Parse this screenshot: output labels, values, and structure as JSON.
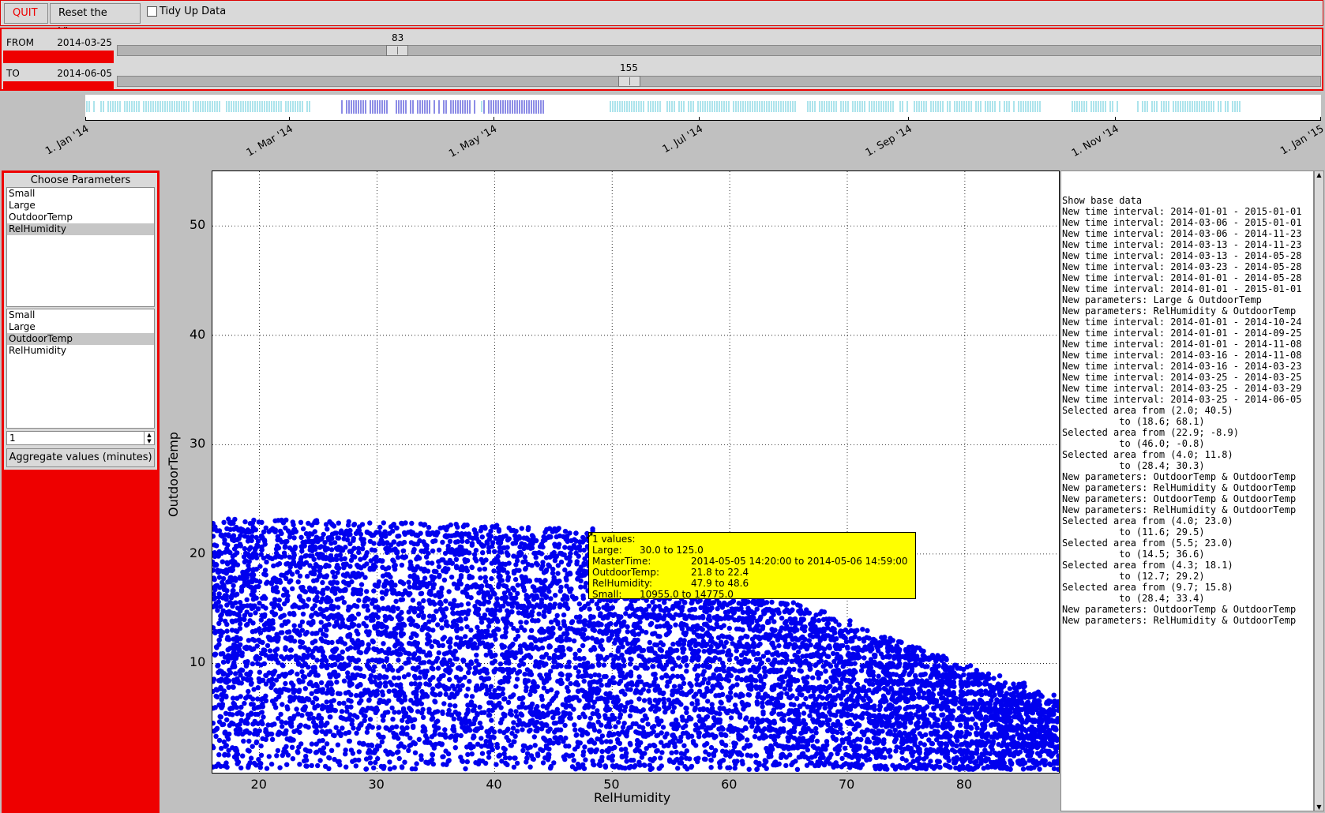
{
  "toolbar": {
    "quit_label": "QUIT",
    "reset_label": "Reset the View",
    "tidy_label": "Tidy Up Data"
  },
  "range": {
    "from_label": "FROM",
    "from_date": "2014-03-25",
    "from_value": "83",
    "to_label": "TO",
    "to_date": "2014-06-05",
    "to_value": "155"
  },
  "timeline": {
    "ticks": [
      "1. Jan '14",
      "1. Mar '14",
      "1. May '14",
      "1. Jul '14",
      "1. Sep '14",
      "1. Nov '14",
      "1. Jan '15"
    ]
  },
  "params": {
    "title": "Choose Parameters",
    "list1": [
      "Small",
      "Large",
      "OutdoorTemp",
      "RelHumidity"
    ],
    "list1_selected": "RelHumidity",
    "list2": [
      "Small",
      "Large",
      "OutdoorTemp",
      "RelHumidity"
    ],
    "list2_selected": "OutdoorTemp",
    "spin_value": "1",
    "aggregate_label": "Aggregate values (minutes)"
  },
  "plot": {
    "xlabel": "RelHumidity",
    "ylabel": "OutdoorTemp",
    "x_ticks": [
      "20",
      "30",
      "40",
      "50",
      "60",
      "70",
      "80"
    ],
    "y_ticks": [
      "10",
      "20",
      "30",
      "40",
      "50"
    ],
    "xlim": [
      16,
      88
    ],
    "ylim": [
      0,
      55
    ],
    "point_color": "#0000ee",
    "grid": true
  },
  "tooltip": {
    "header": "1 values:",
    "rows": [
      {
        "k": "Large:",
        "v": "30.0 to 125.0"
      },
      {
        "k": "MasterTime:",
        "v": "2014-05-05 14:20:00 to 2014-05-06 14:59:00"
      },
      {
        "k": "OutdoorTemp:",
        "v": "21.8 to 22.4"
      },
      {
        "k": "RelHumidity:",
        "v": "47.9 to 48.6"
      },
      {
        "k": "Small:",
        "v": "10955.0 to 14775.0"
      }
    ]
  },
  "log": {
    "lines": [
      "Show base data",
      "New time interval: 2014-01-01 - 2015-01-01",
      "New time interval: 2014-03-06 - 2015-01-01",
      "New time interval: 2014-03-06 - 2014-11-23",
      "New time interval: 2014-03-13 - 2014-11-23",
      "New time interval: 2014-03-13 - 2014-05-28",
      "New time interval: 2014-03-23 - 2014-05-28",
      "New time interval: 2014-01-01 - 2014-05-28",
      "New time interval: 2014-01-01 - 2015-01-01",
      "New parameters: Large & OutdoorTemp",
      "New parameters: RelHumidity & OutdoorTemp",
      "New time interval: 2014-01-01 - 2014-10-24",
      "New time interval: 2014-01-01 - 2014-09-25",
      "New time interval: 2014-01-01 - 2014-11-08",
      "New time interval: 2014-03-16 - 2014-11-08",
      "New time interval: 2014-03-16 - 2014-03-23",
      "New time interval: 2014-03-25 - 2014-03-25",
      "New time interval: 2014-03-25 - 2014-03-29",
      "New time interval: 2014-03-25 - 2014-06-05",
      "Selected area from (2.0; 40.5)",
      "          to (18.6; 68.1)",
      "Selected area from (22.9; -8.9)",
      "          to (46.0; -0.8)",
      "Selected area from (4.0; 11.8)",
      "          to (28.4; 30.3)",
      "New parameters: OutdoorTemp & OutdoorTemp",
      "New parameters: RelHumidity & OutdoorTemp",
      "New parameters: OutdoorTemp & OutdoorTemp",
      "New parameters: RelHumidity & OutdoorTemp",
      "Selected area from (4.0; 23.0)",
      "          to (11.6; 29.5)",
      "Selected area from (5.5; 23.0)",
      "          to (14.5; 36.6)",
      "Selected area from (4.3; 18.1)",
      "          to (12.7; 29.2)",
      "Selected area from (9.7; 15.8)",
      "          to (28.4; 33.4)",
      "New parameters: OutdoorTemp & OutdoorTemp",
      "New parameters: RelHumidity & OutdoorTemp"
    ]
  }
}
